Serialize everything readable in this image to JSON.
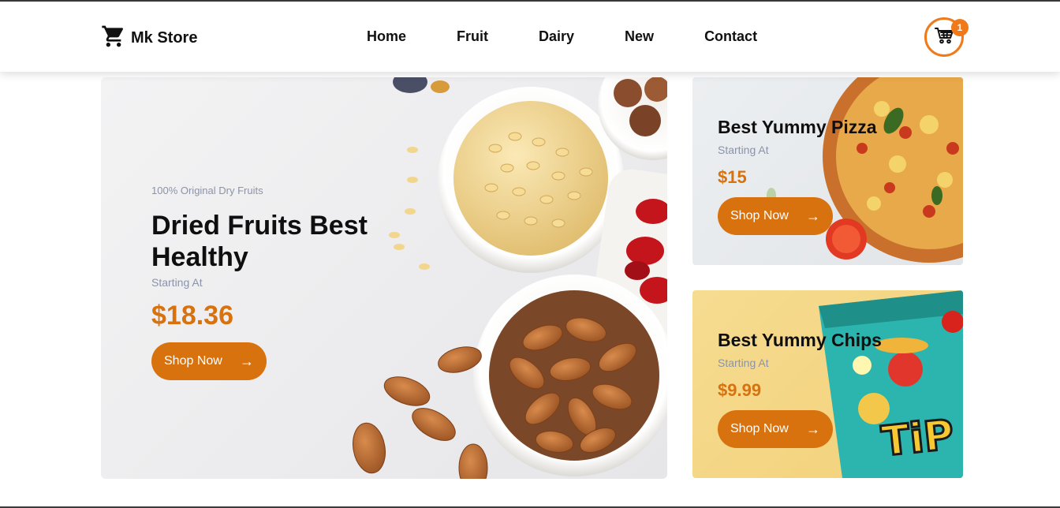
{
  "header": {
    "brand_name": "Mk Store",
    "nav": [
      "Home",
      "Fruit",
      "Dairy",
      "New",
      "Contact"
    ],
    "cart_count": "1"
  },
  "hero": {
    "kicker": "100% Original Dry Fruits",
    "title": "Dried Fruits Best Healthy",
    "starting_label": "Starting At",
    "price": "$18.36",
    "button_label": "Shop Now",
    "button_icon": "arrow-right-icon",
    "image": "dried-fruits-bowls-image"
  },
  "cards": [
    {
      "title": "Best Yummy Pizza",
      "starting_label": "Starting At",
      "price": "$15",
      "button_label": "Shop Now",
      "image": "pizza-image"
    },
    {
      "title": "Best Yummy Chips",
      "starting_label": "Starting At",
      "price": "$9.99",
      "button_label": "Shop Now",
      "image": "chips-packet-image",
      "image_text": "TiP"
    }
  ],
  "colors": {
    "accent": "#d8720f",
    "badge": "#f07a1a",
    "muted_text": "#8a93a8"
  }
}
